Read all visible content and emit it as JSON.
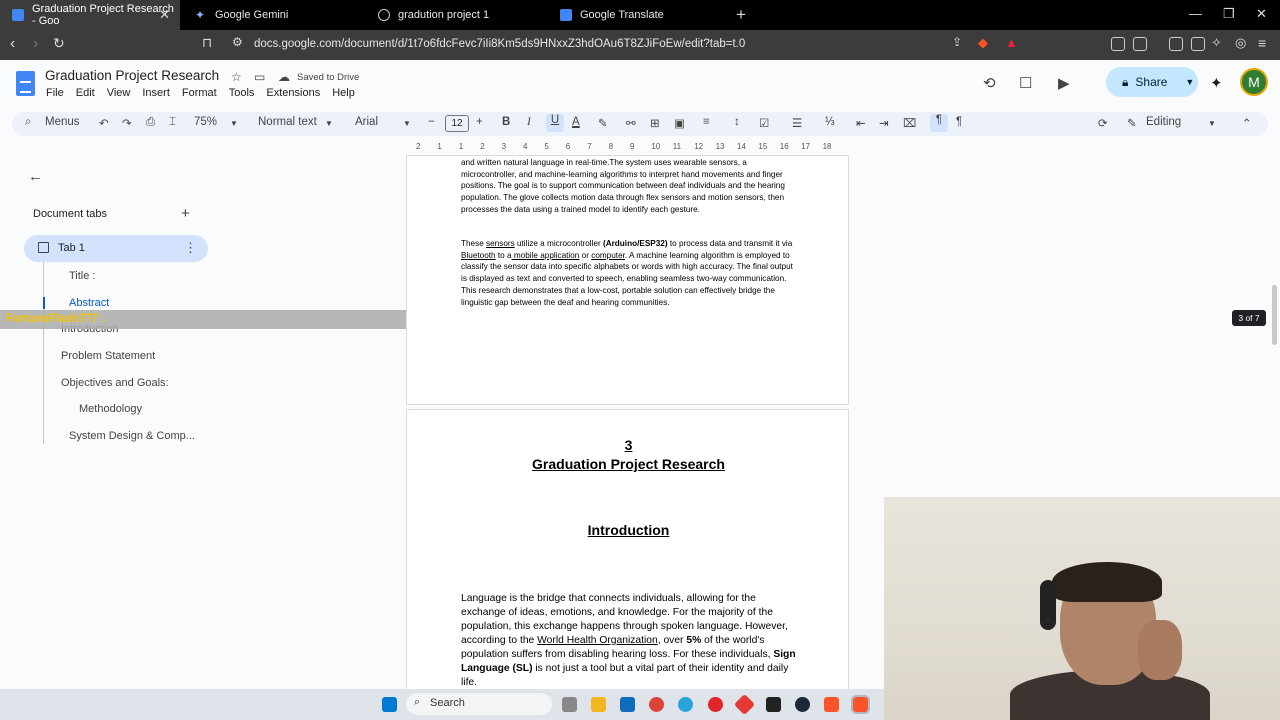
{
  "browser": {
    "tabs": [
      {
        "title": "Graduation Project Research - Goo",
        "active": true,
        "favicon_color": "#4285f4"
      },
      {
        "title": "Google Gemini",
        "active": false,
        "favicon_color": "#8ab4f8"
      },
      {
        "title": "gradution project 1",
        "active": false,
        "favicon_color": "#cccccc"
      },
      {
        "title": "Google Translate",
        "active": false,
        "favicon_color": "#4285f4"
      }
    ],
    "url": "docs.google.com/document/d/1t7o6fdcFevc7iIi8Km5ds9HNxxZ3hdOAu6T8ZJiFoEw/edit?tab=t.0",
    "ext_badge": "1"
  },
  "doc": {
    "title": "Graduation Project Research",
    "saved_status": "Saved to Drive",
    "menu": [
      "File",
      "Edit",
      "View",
      "Insert",
      "Format",
      "Tools",
      "Extensions",
      "Help"
    ],
    "share_label": "Share",
    "avatar_letter": "M"
  },
  "toolbar": {
    "menus_label": "Menus",
    "zoom": "75%",
    "style": "Normal text",
    "font": "Arial",
    "font_size": "12",
    "mode": "Editing"
  },
  "ruler": [
    "2",
    "1",
    "1",
    "2",
    "3",
    "4",
    "5",
    "6",
    "7",
    "8",
    "9",
    "10",
    "11",
    "12",
    "13",
    "14",
    "15",
    "16",
    "17",
    "18"
  ],
  "sidebar": {
    "heading": "Document tabs",
    "tab_label": "Tab 1",
    "outline": [
      "Title :",
      "Abstract",
      "Introduction",
      "Problem Statement",
      "Objectives and Goals:",
      "Methodology",
      "System Design & Comp..."
    ]
  },
  "overlay_text": "FortuneFlash777 :",
  "page1": {
    "para1": "and written natural language in real-time.The system uses wearable sensors, a microcontroller, and machine-learning algorithms to interpret hand movements and finger positions. The goal is to support communication between deaf individuals and the hearing population. The glove collects motion data through flex sensors and motion sensors, then processes the data using a trained model to identify each gesture.",
    "para2_a": "These ",
    "para2_sensors": "sensors",
    "para2_b": " utilize a microcontroller ",
    "para2_bold": "(Arduino/ESP32)",
    "para2_c": " to process data and transmit it via ",
    "para2_bt": "Bluetooth",
    "para2_d": " to a",
    "para2_app": " mobile application",
    "para2_e": " or ",
    "para2_comp": "computer",
    "para2_f": ". A machine learning algorithm is employed to classify the sensor data into specific alphabets or words with high accuracy. The final output is displayed as text and converted to speech, enabling seamless two-way communication. This research demonstrates that a low-cost, portable solution can effectively bridge the linguistic gap between the deaf and hearing communities."
  },
  "page2": {
    "number": "3",
    "title": "Graduation Project Research",
    "heading": "Introduction",
    "p_a": "Language is the bridge that connects individuals, allowing for the exchange of ideas, emotions, and knowledge. For the majority of the population, this exchange happens through spoken language. However, according to the ",
    "p_who": "World Health Organization",
    "p_b": ", over ",
    "p_pct": "5%",
    "p_c": " of the world's population suffers from disabling hearing loss. For these individuals, ",
    "p_sl": "Sign Language (SL)",
    "p_d": " is not just a tool but a vital part of their identity and daily life."
  },
  "page_indicator": "3 of 7",
  "taskbar": {
    "search_label": "Search"
  }
}
